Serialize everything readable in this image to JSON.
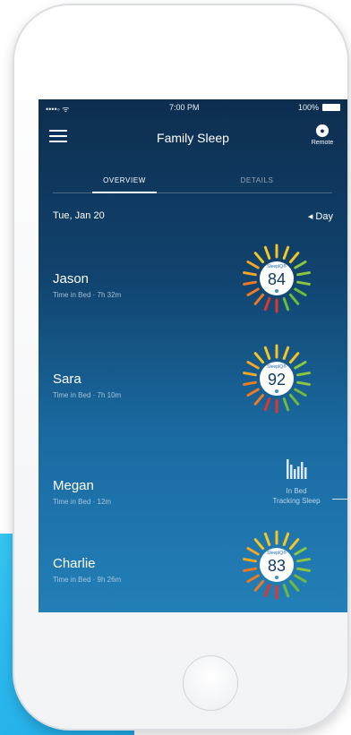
{
  "status_bar": {
    "signal": "••••◦ ᯤ",
    "time": "7:00 PM",
    "battery": "100%"
  },
  "header": {
    "title": "Family Sleep",
    "remote_label": "Remote",
    "remote_icon": "person-icon"
  },
  "tabs": [
    {
      "label": "OVERVIEW",
      "active": true
    },
    {
      "label": "DETAILS",
      "active": false
    }
  ],
  "date": {
    "label": "Tue, Jan 20",
    "range": "◂ Day"
  },
  "people": [
    {
      "name": "Jason",
      "time_in_bed": "Time in Bed · 7h 32m",
      "score": "84",
      "score_label": "SleepIQ®"
    },
    {
      "name": "Sara",
      "time_in_bed": "Time in Bed · 7h 10m",
      "score": "92",
      "score_label": "SleepIQ®"
    },
    {
      "name": "Megan",
      "time_in_bed": "Time in Bed · 12m",
      "status_line1": "In Bed",
      "status_line2": "Tracking Sleep"
    },
    {
      "name": "Charlie",
      "time_in_bed": "Time in Bed · 9h 26m",
      "score": "83",
      "score_label": "SleepIQ®"
    }
  ],
  "colors": {
    "accent_blue": "#1ea6e6",
    "screen_top": "#0d2d4f",
    "screen_bottom": "#237fb7"
  }
}
